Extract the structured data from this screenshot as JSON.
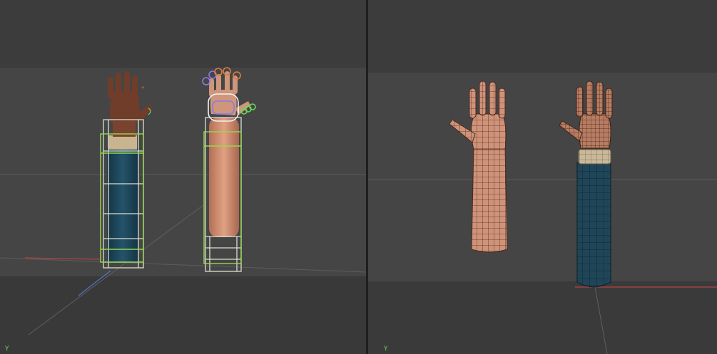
{
  "viewports": {
    "left": {
      "axis_label": "Y"
    },
    "right": {
      "axis_label": "Y"
    }
  },
  "colors": {
    "viewport_bg": "#444444",
    "viewport_top": "#3c3c3c",
    "floor": "#393939",
    "skin": "#c98d74",
    "skin_dark": "#6b3a28",
    "sleeve": "#1f4658",
    "cuff": "#c9b99a",
    "bbox_green": "#96d850",
    "bbox_white": "#e8e8e8",
    "axis_green": "#6bd65a",
    "axis_red": "#c05050",
    "axis_blue": "#4a7acf",
    "gizmo_orange": "#d97e45",
    "gizmo_purple": "#8b79e6"
  },
  "icons": [
    "axis-gizmo-icon"
  ]
}
